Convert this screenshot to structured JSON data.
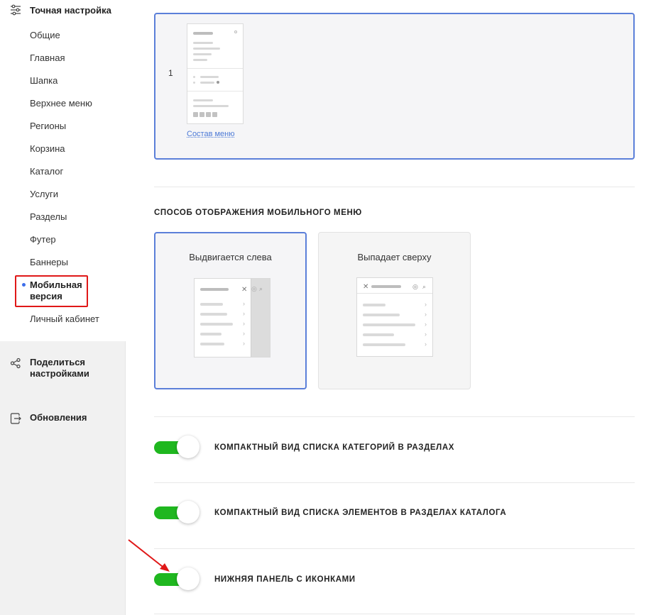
{
  "sidebar": {
    "heading": "Точная настройка",
    "items": [
      "Общие",
      "Главная",
      "Шапка",
      "Верхнее меню",
      "Регионы",
      "Корзина",
      "Каталог",
      "Услуги",
      "Разделы",
      "Футер",
      "Баннеры",
      "Мобильная версия",
      "Личный кабинет"
    ],
    "active_index": 11,
    "share_label": "Поделиться настройками",
    "updates_label": "Обновления"
  },
  "menu_preview": {
    "number": "1",
    "link_label": "Состав меню"
  },
  "mobile_menu": {
    "title": "СПОСОБ ОТОБРАЖЕНИЯ МОБИЛЬНОГО МЕНЮ",
    "options": [
      "Выдвигается слева",
      "Выпадает сверху"
    ],
    "selected_index": 0
  },
  "toggles": [
    {
      "label": "КОМПАКТНЫЙ ВИД СПИСКА КАТЕГОРИЙ В РАЗДЕЛАХ",
      "on": true
    },
    {
      "label": "КОМПАКТНЫЙ ВИД СПИСКА ЭЛЕМЕНТОВ В РАЗДЕЛАХ КАТАЛОГА",
      "on": true
    },
    {
      "label": "НИЖНЯЯ ПАНЕЛЬ С ИКОНКАМИ",
      "on": true
    }
  ],
  "colors": {
    "accent": "#5b7fd9",
    "toggle_on": "#1fb71f",
    "highlight": "#e01818"
  }
}
